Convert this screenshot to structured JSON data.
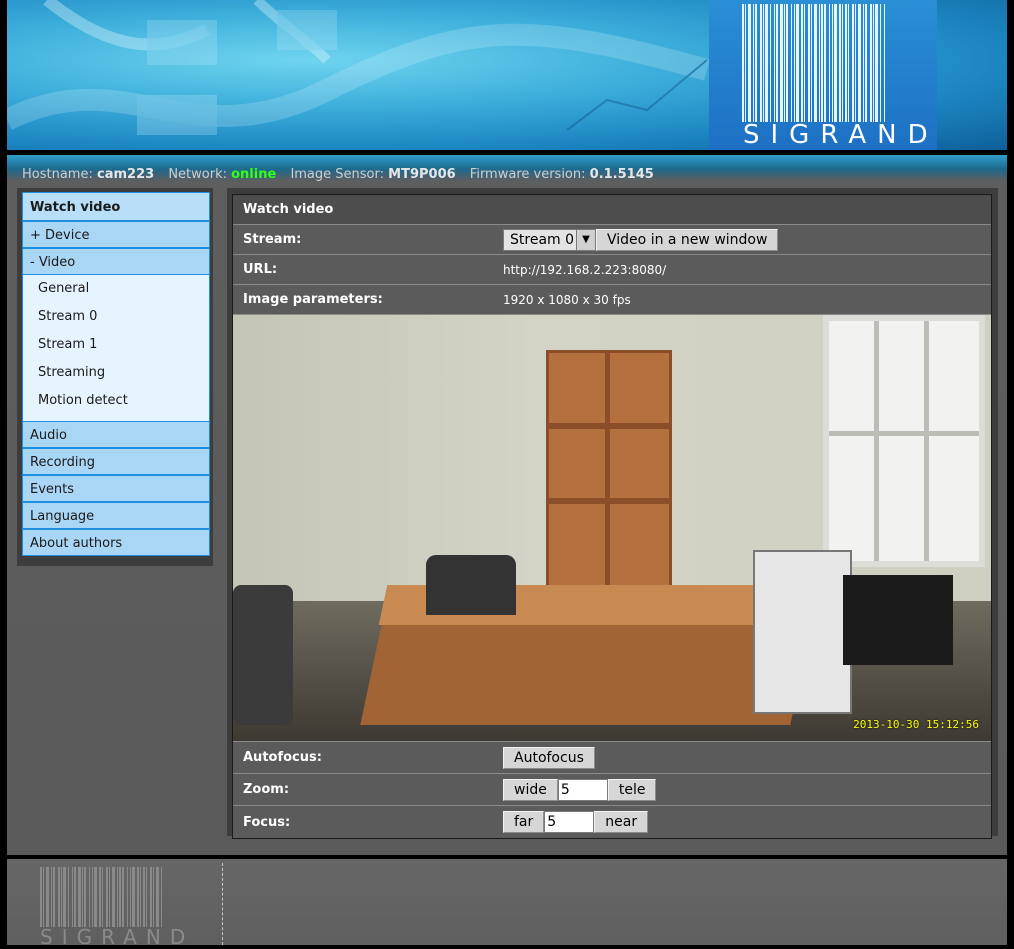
{
  "info": {
    "hostname_label": "Hostname:",
    "hostname": "cam223",
    "network_label": "Network:",
    "network": "online",
    "sensor_label": "Image Sensor:",
    "sensor": "MT9P006",
    "firmware_label": "Firmware version:",
    "firmware": "0.1.5145"
  },
  "logo_text": "SIGRAND",
  "sidebar": {
    "items": [
      {
        "label": "Watch video"
      },
      {
        "label": "+ Device"
      },
      {
        "label": "- Video"
      },
      {
        "label": "Audio"
      },
      {
        "label": "Recording"
      },
      {
        "label": "Events"
      },
      {
        "label": "Language"
      },
      {
        "label": "About authors"
      }
    ],
    "video_sub": [
      "General",
      "Stream 0",
      "Stream 1",
      "Streaming",
      "Motion detect"
    ]
  },
  "panel": {
    "title": "Watch video",
    "stream_label": "Stream:",
    "stream_selected": "Stream 0",
    "new_window_button": "Video in a new window",
    "url_label": "URL:",
    "url_value": "http://192.168.2.223:8080/",
    "image_params_label": "Image parameters:",
    "image_params_value": "1920 x 1080 x 30 fps",
    "video_timestamp": "2013-10-30 15:12:56",
    "autofocus_label": "Autofocus:",
    "autofocus_button": "Autofocus",
    "zoom_label": "Zoom:",
    "zoom_wide": "wide",
    "zoom_value": "5",
    "zoom_tele": "tele",
    "focus_label": "Focus:",
    "focus_far": "far",
    "focus_value": "5",
    "focus_near": "near"
  },
  "colors": {
    "online": "#2cff18",
    "nav_bg": "#a9d6f5",
    "nav_border": "#1f8fe0"
  }
}
